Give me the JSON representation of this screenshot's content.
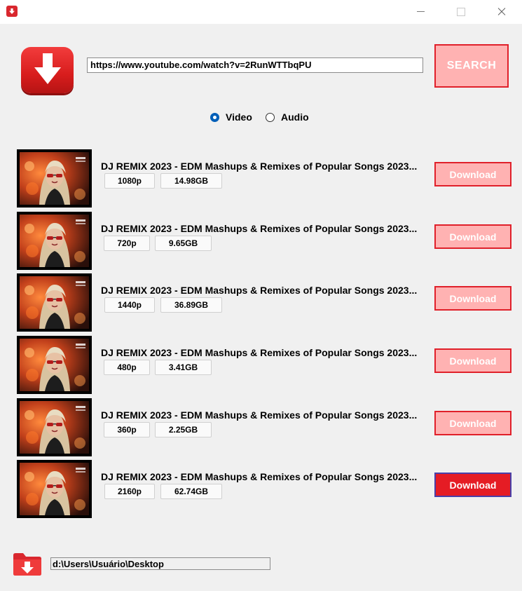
{
  "window": {
    "title": "",
    "icon": "download-app-icon",
    "controls": [
      "minimize",
      "maximize",
      "close"
    ]
  },
  "search": {
    "url_value": "https://www.youtube.com/watch?v=2RunWTTbqPU",
    "button_label": "SEARCH"
  },
  "format": {
    "options": [
      {
        "label": "Video",
        "checked": true
      },
      {
        "label": "Audio",
        "checked": false
      }
    ]
  },
  "results": [
    {
      "title": "DJ REMIX 2023 - EDM Mashups & Remixes of Popular Songs 2023...",
      "resolution": "1080p",
      "size": "14.98GB",
      "button": "Download",
      "state": "disabled"
    },
    {
      "title": "DJ REMIX 2023 - EDM Mashups & Remixes of Popular Songs 2023...",
      "resolution": "720p",
      "size": "9.65GB",
      "button": "Download",
      "state": "disabled"
    },
    {
      "title": "DJ REMIX 2023 - EDM Mashups & Remixes of Popular Songs 2023...",
      "resolution": "1440p",
      "size": "36.89GB",
      "button": "Download",
      "state": "disabled"
    },
    {
      "title": "DJ REMIX 2023 - EDM Mashups & Remixes of Popular Songs 2023...",
      "resolution": "480p",
      "size": "3.41GB",
      "button": "Download",
      "state": "disabled"
    },
    {
      "title": "DJ REMIX 2023 - EDM Mashups & Remixes of Popular Songs 2023...",
      "resolution": "360p",
      "size": "2.25GB",
      "button": "Download",
      "state": "disabled"
    },
    {
      "title": "DJ REMIX 2023 - EDM Mashups & Remixes of Popular Songs 2023...",
      "resolution": "2160p",
      "size": "62.74GB",
      "button": "Download",
      "state": "active"
    }
  ],
  "output": {
    "folder_icon": "folder-download-icon",
    "path_value": "d:\\Users\\Usuário\\Desktop"
  },
  "colors": {
    "accent": "#e51c24",
    "button_disabled_bg": "#ffb2b2",
    "radio_selected": "#005fb8"
  }
}
